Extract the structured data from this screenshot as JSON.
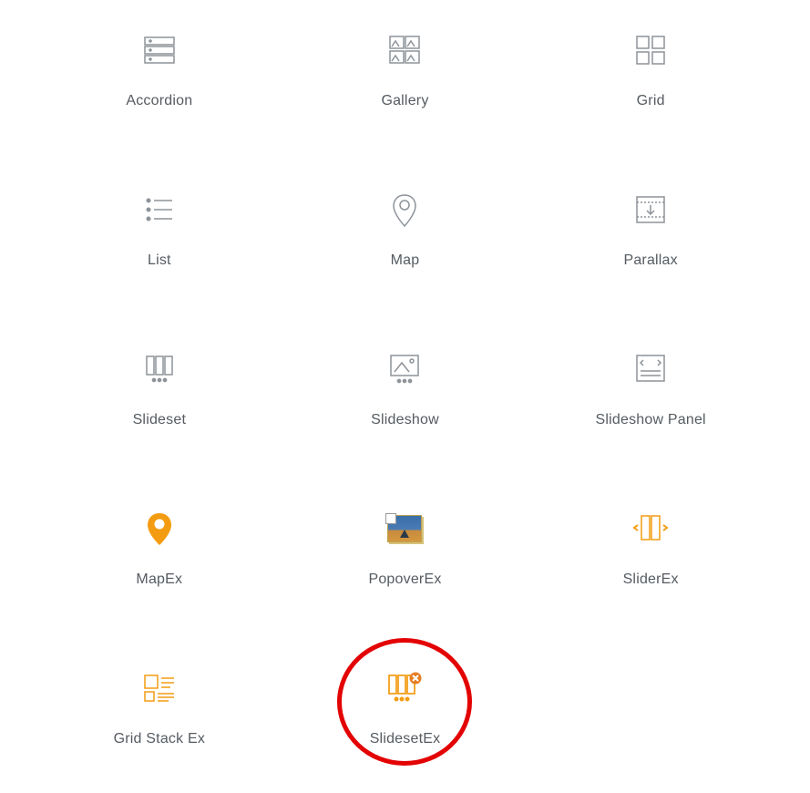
{
  "items": [
    {
      "id": "accordion",
      "label": "Accordion",
      "icon": "accordion-icon",
      "tint": "gray",
      "highlighted": false
    },
    {
      "id": "gallery",
      "label": "Gallery",
      "icon": "gallery-icon",
      "tint": "gray",
      "highlighted": false
    },
    {
      "id": "grid",
      "label": "Grid",
      "icon": "grid-icon",
      "tint": "gray",
      "highlighted": false
    },
    {
      "id": "list",
      "label": "List",
      "icon": "list-icon",
      "tint": "gray",
      "highlighted": false
    },
    {
      "id": "map",
      "label": "Map",
      "icon": "map-pin-icon",
      "tint": "gray",
      "highlighted": false
    },
    {
      "id": "parallax",
      "label": "Parallax",
      "icon": "parallax-icon",
      "tint": "gray",
      "highlighted": false
    },
    {
      "id": "slideset",
      "label": "Slideset",
      "icon": "slideset-icon",
      "tint": "gray",
      "highlighted": false
    },
    {
      "id": "slideshow",
      "label": "Slideshow",
      "icon": "slideshow-icon",
      "tint": "gray",
      "highlighted": false
    },
    {
      "id": "slideshow-panel",
      "label": "Slideshow Panel",
      "icon": "slideshowpanel-icon",
      "tint": "gray",
      "highlighted": false
    },
    {
      "id": "mapex",
      "label": "MapEx",
      "icon": "mapex-icon",
      "tint": "orange",
      "highlighted": false
    },
    {
      "id": "popoverex",
      "label": "PopoverEx",
      "icon": "popoverex-icon",
      "tint": "image",
      "highlighted": false
    },
    {
      "id": "sliderex",
      "label": "SliderEx",
      "icon": "sliderex-icon",
      "tint": "orange",
      "highlighted": false
    },
    {
      "id": "gridstackex",
      "label": "Grid Stack Ex",
      "icon": "gridstackex-icon",
      "tint": "orange",
      "highlighted": false
    },
    {
      "id": "slidesetex",
      "label": "SlidesetEx",
      "icon": "slidesetex-icon",
      "tint": "orange",
      "highlighted": true
    }
  ],
  "colors": {
    "gray": "#8d9399",
    "orange": "#f39c12",
    "highlight": "#e30303",
    "text": "#555b61"
  }
}
